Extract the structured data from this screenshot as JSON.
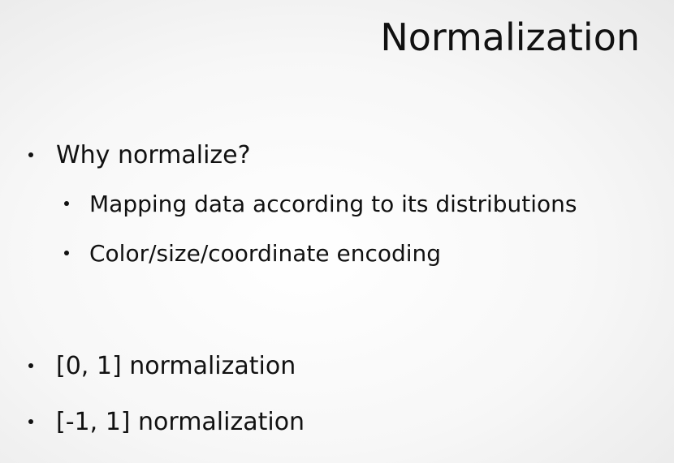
{
  "title": "Normalization",
  "bullets": [
    {
      "text": "Why normalize?",
      "level": 1
    },
    {
      "text": "Mapping data according to its distributions",
      "level": 2
    },
    {
      "text": "Color/size/coordinate encoding",
      "level": 2
    },
    {
      "text": "[0, 1] normalization",
      "level": 1
    },
    {
      "text": "[-1, 1] normalization",
      "level": 1
    }
  ]
}
